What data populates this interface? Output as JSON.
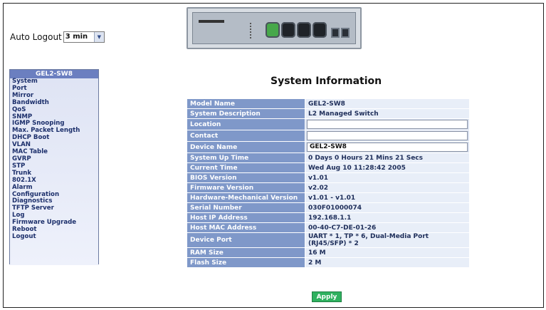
{
  "logout": {
    "label": "Auto Logout",
    "value": "3 min",
    "arrow_icon": "chevron-down-icon"
  },
  "sidebar": {
    "title": "GEL2-SW8",
    "items": [
      "System",
      "Port",
      "Mirror",
      "Bandwidth",
      "QoS",
      "SNMP",
      "IGMP Snooping",
      "Max. Packet Length",
      "DHCP Boot",
      "VLAN",
      "MAC Table",
      "GVRP",
      "STP",
      "Trunk",
      "802.1X",
      "Alarm",
      "Configuration",
      "Diagnostics",
      "TFTP Server",
      "Log",
      "Firmware Upgrade",
      "Reboot",
      "Logout"
    ]
  },
  "page": {
    "title": "System Information"
  },
  "info": {
    "rows": [
      {
        "key": "Model Name",
        "value": "GEL2-SW8"
      },
      {
        "key": "System Description",
        "value": "L2 Managed Switch"
      },
      {
        "key": "Location",
        "value": ""
      },
      {
        "key": "Contact",
        "value": ""
      },
      {
        "key": "Device Name",
        "value": "GEL2-SW8"
      },
      {
        "key": "System Up Time",
        "value": "0 Days 0 Hours 21 Mins 21 Secs"
      },
      {
        "key": "Current Time",
        "value": "Wed Aug 10 11:28:42 2005"
      },
      {
        "key": "BIOS Version",
        "value": "v1.01"
      },
      {
        "key": "Firmware Version",
        "value": "v2.02"
      },
      {
        "key": "Hardware-Mechanical Version",
        "value": "v1.01 - v1.01"
      },
      {
        "key": "Serial Number",
        "value": "030F01000074"
      },
      {
        "key": "Host IP Address",
        "value": "192.168.1.1"
      },
      {
        "key": "Host MAC Address",
        "value": "00-40-C7-DE-01-26"
      },
      {
        "key": "Device Port",
        "value": "UART * 1, TP * 6, Dual-Media Port (RJ45/SFP) * 2"
      },
      {
        "key": "RAM Size",
        "value": "16 M"
      },
      {
        "key": "Flash Size",
        "value": "2 M"
      }
    ]
  },
  "actions": {
    "apply_label": "Apply"
  },
  "colors": {
    "key_bg": "#7f98c9",
    "value_bg": "#e8eef8",
    "sidebar_head": "#6b7fc0",
    "apply_bg": "#2fb15f"
  }
}
